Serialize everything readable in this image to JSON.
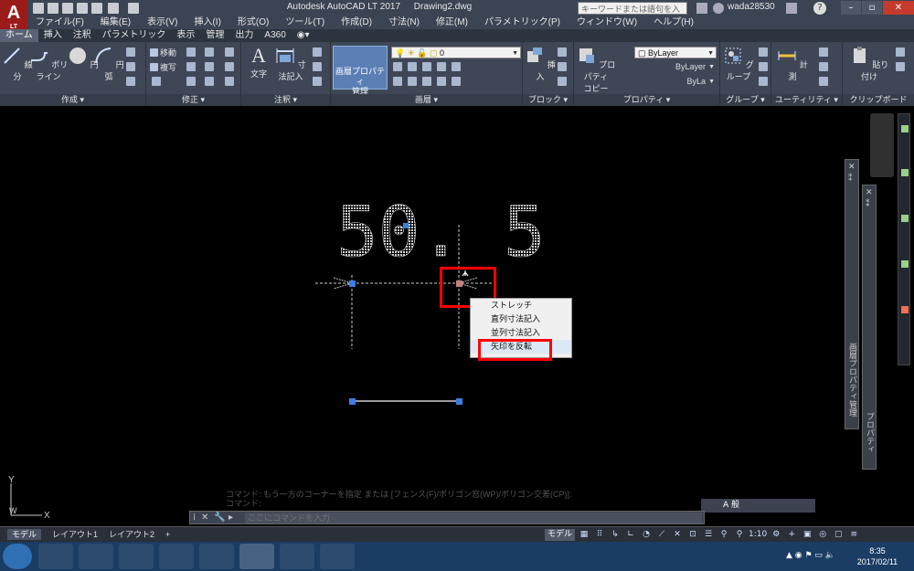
{
  "titlebar": {
    "app_name": "Autodesk AutoCAD LT 2017",
    "document": "Drawing2.dwg",
    "search_placeholder": "キーワードまたは語句を入力",
    "user": "wada28530",
    "logo_letter": "A",
    "logo_sub": "LT"
  },
  "menus": [
    "ファイル(F)",
    "編集(E)",
    "表示(V)",
    "挿入(I)",
    "形式(O)",
    "ツール(T)",
    "作成(D)",
    "寸法(N)",
    "修正(M)",
    "パラメトリック(P)",
    "ウィンドウ(W)",
    "ヘルプ(H)"
  ],
  "ribbon_tabs": [
    "ホーム",
    "挿入",
    "注釈",
    "パラメトリック",
    "表示",
    "管理",
    "出力",
    "A360"
  ],
  "ribbon": {
    "draw": {
      "title": "作成 ▾",
      "line": "線分",
      "polyline": "ポリライン",
      "circle": "円",
      "arc": "円弧"
    },
    "modify": {
      "title": "修正 ▾",
      "move": "移動",
      "copy": "複写"
    },
    "annotation": {
      "title": "注釈 ▾",
      "text": "文字",
      "dimension": "寸法記入"
    },
    "layers": {
      "title": "画層 ▾",
      "layer_props": "画層プロパティ",
      "layer_props2": "管理",
      "layer_value": "0"
    },
    "block": {
      "title": "ブロック ▾",
      "insert": "挿入"
    },
    "properties": {
      "title": "プロパティ ▾",
      "match": "プロパティ",
      "match2": "コピー",
      "color": "ByLayer",
      "linetype": "ByLayer",
      "lineweight": "ByLa"
    },
    "groups": {
      "title": "グループ ▾",
      "group": "グループ"
    },
    "utilities": {
      "title": "ユーティリティ ▾",
      "measure": "計測"
    },
    "clipboard": {
      "title": "クリップボード",
      "paste": "貼り付け"
    }
  },
  "drawing": {
    "dimension_text": "50. 5"
  },
  "context_menu": {
    "items": [
      "ストレッチ",
      "直列寸法記入",
      "並列寸法記入",
      "矢印を反転"
    ],
    "highlighted": 3
  },
  "palettes": {
    "layer_palette_label": "画層プロパティ管理",
    "properties_palette_label": "プロパティ"
  },
  "command": {
    "history_line1": "コマンド: もう一方のコーナーを指定 または [フェンス(F)/ポリゴン窓(WP)/ポリゴン交差(CP)]:",
    "history_line2": "コマンド:",
    "placeholder": "ここにコマンドを入力",
    "tray_text": "A 般"
  },
  "ucs": {
    "y": "Y",
    "x": "X",
    "w": "W"
  },
  "layouts": [
    "モデル",
    "レイアウト1",
    "レイアウト2",
    "+"
  ],
  "status": {
    "model": "モデル",
    "scale": "1:10"
  },
  "clock": {
    "time": "8:35",
    "date": "2017/02/11"
  }
}
